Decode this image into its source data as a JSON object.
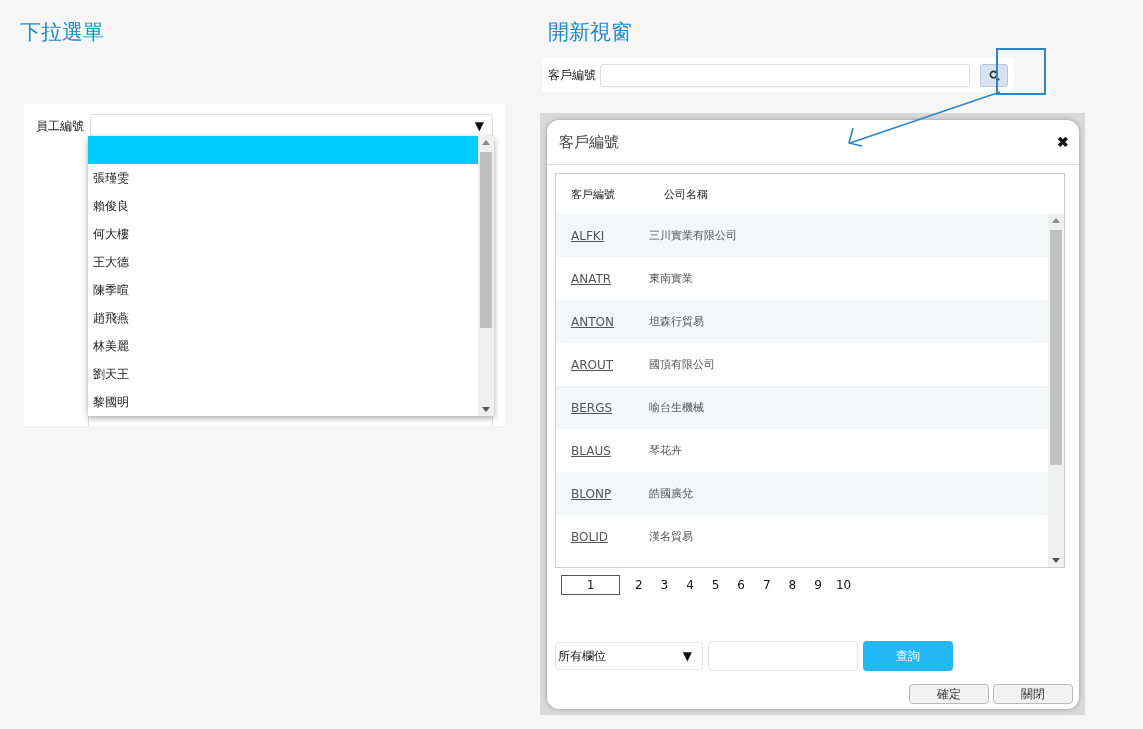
{
  "dropdown_demo": {
    "title": "下拉選單",
    "field_label": "員工編號",
    "arrow": "▼",
    "blank_option": {
      "selected": true
    },
    "options": [
      {
        "label": "張瑾雯",
        "selected": false
      },
      {
        "label": "賴俊良",
        "selected": false
      },
      {
        "label": "何大樓",
        "selected": false
      },
      {
        "label": "王大德",
        "selected": false
      },
      {
        "label": "陳季暄",
        "selected": false
      },
      {
        "label": "趙飛燕",
        "selected": false
      },
      {
        "label": "林美麗",
        "selected": false
      },
      {
        "label": "劉天王",
        "selected": false
      },
      {
        "label": "黎國明",
        "selected": false
      }
    ]
  },
  "popup_demo": {
    "title": "開新視窗",
    "field_label": "客戶編號",
    "dialog": {
      "title": "客戶編號",
      "close": "✖",
      "columns": [
        "客戶編號",
        "公司名稱"
      ],
      "rows": [
        {
          "id": "ALFKI",
          "company": "三川實業有限公司"
        },
        {
          "id": "ANATR",
          "company": "東南實業"
        },
        {
          "id": "ANTON",
          "company": "坦森行貿易"
        },
        {
          "id": "AROUT",
          "company": "國頂有限公司"
        },
        {
          "id": "BERGS",
          "company": "喻台生機械"
        },
        {
          "id": "BLAUS",
          "company": "琴花卉"
        },
        {
          "id": "BLONP",
          "company": "皓國廣兌"
        },
        {
          "id": "BOLID",
          "company": "漢名貿易"
        }
      ],
      "pages": [
        {
          "label": "1",
          "selected": true
        },
        {
          "label": "2",
          "selected": false
        },
        {
          "label": "3",
          "selected": false
        },
        {
          "label": "4",
          "selected": false
        },
        {
          "label": "5",
          "selected": false
        },
        {
          "label": "6",
          "selected": false
        },
        {
          "label": "7",
          "selected": false
        },
        {
          "label": "8",
          "selected": false
        },
        {
          "label": "9",
          "selected": false
        },
        {
          "label": "10",
          "selected": false
        }
      ],
      "filter_field": "所有欄位",
      "filter_arrow": "▼",
      "search_button": "查詢",
      "buttons": [
        "確定",
        "關閉"
      ]
    }
  }
}
